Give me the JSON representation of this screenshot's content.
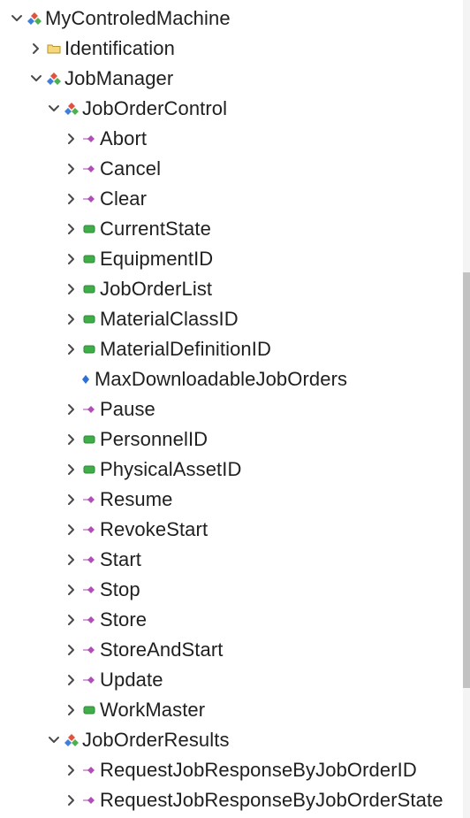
{
  "tree": {
    "nodes": [
      {
        "label": "MyControledMachine",
        "indent": 0,
        "toggle": "expanded",
        "icon": "object-icon"
      },
      {
        "label": "Identification",
        "indent": 1,
        "toggle": "collapsed",
        "icon": "folder-icon"
      },
      {
        "label": "JobManager",
        "indent": 1,
        "toggle": "expanded",
        "icon": "object-icon"
      },
      {
        "label": "JobOrderControl",
        "indent": 2,
        "toggle": "expanded",
        "icon": "object-icon"
      },
      {
        "label": "Abort",
        "indent": 3,
        "toggle": "collapsed",
        "icon": "method-icon"
      },
      {
        "label": "Cancel",
        "indent": 3,
        "toggle": "collapsed",
        "icon": "method-icon"
      },
      {
        "label": "Clear",
        "indent": 3,
        "toggle": "collapsed",
        "icon": "method-icon"
      },
      {
        "label": "CurrentState",
        "indent": 3,
        "toggle": "collapsed",
        "icon": "variable-icon"
      },
      {
        "label": "EquipmentID",
        "indent": 3,
        "toggle": "collapsed",
        "icon": "variable-icon"
      },
      {
        "label": "JobOrderList",
        "indent": 3,
        "toggle": "collapsed",
        "icon": "variable-icon"
      },
      {
        "label": "MaterialClassID",
        "indent": 3,
        "toggle": "collapsed",
        "icon": "variable-icon"
      },
      {
        "label": "MaterialDefinitionID",
        "indent": 3,
        "toggle": "collapsed",
        "icon": "variable-icon"
      },
      {
        "label": "MaxDownloadableJobOrders",
        "indent": 3,
        "toggle": "none",
        "icon": "property-icon"
      },
      {
        "label": "Pause",
        "indent": 3,
        "toggle": "collapsed",
        "icon": "method-icon"
      },
      {
        "label": "PersonnelID",
        "indent": 3,
        "toggle": "collapsed",
        "icon": "variable-icon"
      },
      {
        "label": "PhysicalAssetID",
        "indent": 3,
        "toggle": "collapsed",
        "icon": "variable-icon"
      },
      {
        "label": "Resume",
        "indent": 3,
        "toggle": "collapsed",
        "icon": "method-icon"
      },
      {
        "label": "RevokeStart",
        "indent": 3,
        "toggle": "collapsed",
        "icon": "method-icon"
      },
      {
        "label": "Start",
        "indent": 3,
        "toggle": "collapsed",
        "icon": "method-icon"
      },
      {
        "label": "Stop",
        "indent": 3,
        "toggle": "collapsed",
        "icon": "method-icon"
      },
      {
        "label": "Store",
        "indent": 3,
        "toggle": "collapsed",
        "icon": "method-icon"
      },
      {
        "label": "StoreAndStart",
        "indent": 3,
        "toggle": "collapsed",
        "icon": "method-icon"
      },
      {
        "label": "Update",
        "indent": 3,
        "toggle": "collapsed",
        "icon": "method-icon"
      },
      {
        "label": "WorkMaster",
        "indent": 3,
        "toggle": "collapsed",
        "icon": "variable-icon"
      },
      {
        "label": "JobOrderResults",
        "indent": 2,
        "toggle": "expanded",
        "icon": "object-icon"
      },
      {
        "label": "RequestJobResponseByJobOrderID",
        "indent": 3,
        "toggle": "collapsed",
        "icon": "method-icon"
      },
      {
        "label": "RequestJobResponseByJobOrderState",
        "indent": 3,
        "toggle": "collapsed",
        "icon": "method-icon"
      }
    ]
  },
  "colors": {
    "text": "#1f1f1f",
    "chevron": "#4a4a4a",
    "method": "#b04fb8",
    "variable": "#3fae49",
    "property": "#2e6fd6",
    "folder": "#e8c25a",
    "object_red": "#e0533f",
    "object_green": "#4caf50",
    "object_blue": "#3d7fd9"
  }
}
